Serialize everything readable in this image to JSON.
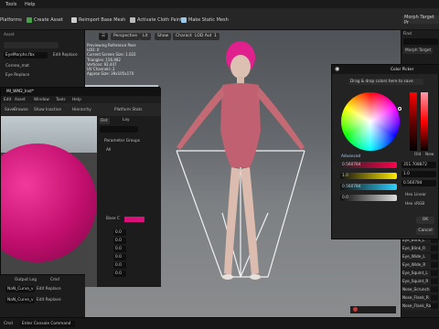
{
  "menubar": {
    "items": [
      "Tools",
      "Help"
    ]
  },
  "toolbar": {
    "buttons": [
      {
        "label": "Platforms",
        "icon": "monitor-icon"
      },
      {
        "label": "Create Asset",
        "icon": "plus-icon"
      },
      {
        "label": "Reimport Base Mesh",
        "icon": "reimport-icon"
      },
      {
        "label": "Activate Cloth Paint",
        "icon": "paint-icon"
      },
      {
        "label": "Make Static Mesh",
        "icon": "mesh-icon"
      }
    ],
    "right_tab": "Morph Target Pr"
  },
  "left_panel": {
    "title": "Asset",
    "asset_name": "EyeMorphs.fbx",
    "rows": [
      "Cornea_mat",
      "Eye Replace"
    ],
    "button": "Edit Replace"
  },
  "viewport": {
    "chips": [
      "Perspective",
      "Lit",
      "Show",
      "Character",
      "LOD Auto",
      "1"
    ],
    "overlay_lines": [
      "Previewing Reference Pose",
      "LOD: 0",
      "Current Screen Size: 1.022",
      "Triangles: 156,982",
      "Vertices: 92,447",
      "UV Channels: 2",
      "Approx Size: 39x105x170"
    ]
  },
  "right_panel": {
    "search_label": "Find",
    "tab": "Morph Target",
    "rows": [
      "Eye_Blink_L",
      "Eye_Blink_R",
      "Eye_Wide_L",
      "Eye_Wide_R",
      "Eye_Squint_L",
      "Eye_Squint_R",
      "Nose_Scrunch",
      "Nose_Flank_R",
      "Nose_Flank_Ra"
    ]
  },
  "material_window": {
    "title": "MI_WM2_Inst*",
    "menu": [
      "Edit",
      "Asset",
      "Window",
      "Tools",
      "Help"
    ],
    "toolbar": [
      "Save",
      "Browse",
      "Show Inactive",
      "Hierarchy",
      "Platform Stats"
    ],
    "tabs": [
      "Det",
      "Lay"
    ],
    "search_placeholder": "Search",
    "section": "Parameter Groups",
    "groups": [
      "All",
      "Base C"
    ],
    "param_values": [
      "0.0",
      "0.0",
      "0.0",
      "0.0",
      "0.0",
      "0.0",
      "0.0",
      "0.0"
    ],
    "base_color": "#d90f7a"
  },
  "output_log": {
    "title": "Output Log",
    "cmd_label": "Cmd",
    "rows": [
      "NaN_Curve_v",
      "NaN_Curve_v"
    ],
    "buttons": [
      "Edit Replace",
      "Edit Replace"
    ]
  },
  "color_picker": {
    "title": "Color Picker",
    "dropdown": "Drag & drop colors here to save",
    "advanced_label": "Advanced",
    "hex_linear": "0.560784",
    "hex_srgb": "351.708872",
    "value_1": "1.0",
    "value_2": "0.560784",
    "value_3": "0.0",
    "value_4": "0.0",
    "hex_linear_label": "Hex Linear",
    "hex_srgb_label": "Hex sRGB",
    "ok": "OK",
    "cancel": "Cancel",
    "old_label": "Old",
    "new_label": "New"
  },
  "status_bar": {
    "items": [
      "Cmd",
      "Enter Console Command"
    ]
  },
  "colors": {
    "accent": "#d90f7a",
    "hair": "#e0208c"
  }
}
